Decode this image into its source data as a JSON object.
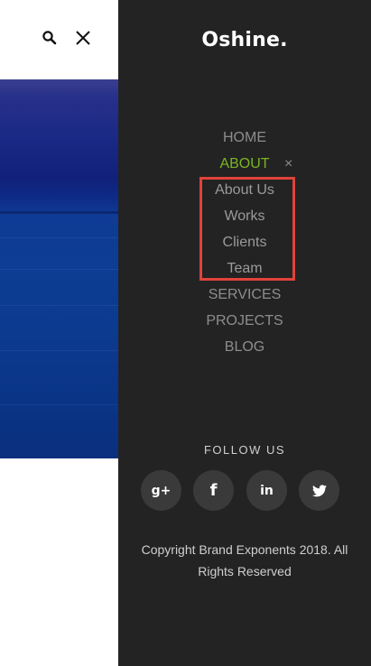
{
  "topbar": {
    "search_icon": "search-icon",
    "close_icon": "close-icon"
  },
  "drawer": {
    "logo": "Oshine.",
    "menu": [
      {
        "label": "HOME"
      },
      {
        "label": "ABOUT",
        "toggle": "×"
      },
      {
        "label": "About Us"
      },
      {
        "label": "Works"
      },
      {
        "label": "Clients"
      },
      {
        "label": "Team"
      },
      {
        "label": "SERVICES"
      },
      {
        "label": "PROJECTS"
      },
      {
        "label": "BLOG"
      }
    ],
    "follow_label": "FOLLOW US",
    "social": [
      {
        "name": "google-plus",
        "glyph": "g+"
      },
      {
        "name": "facebook",
        "glyph": "f"
      },
      {
        "name": "linkedin",
        "glyph": "in"
      },
      {
        "name": "twitter",
        "glyph": "twitter-bird-icon"
      }
    ],
    "copyright": "Copyright Brand Exponents 2018. All Rights Reserved"
  },
  "colors": {
    "drawer_bg": "#232323",
    "active": "#7ab623",
    "highlight": "#e0433a"
  }
}
